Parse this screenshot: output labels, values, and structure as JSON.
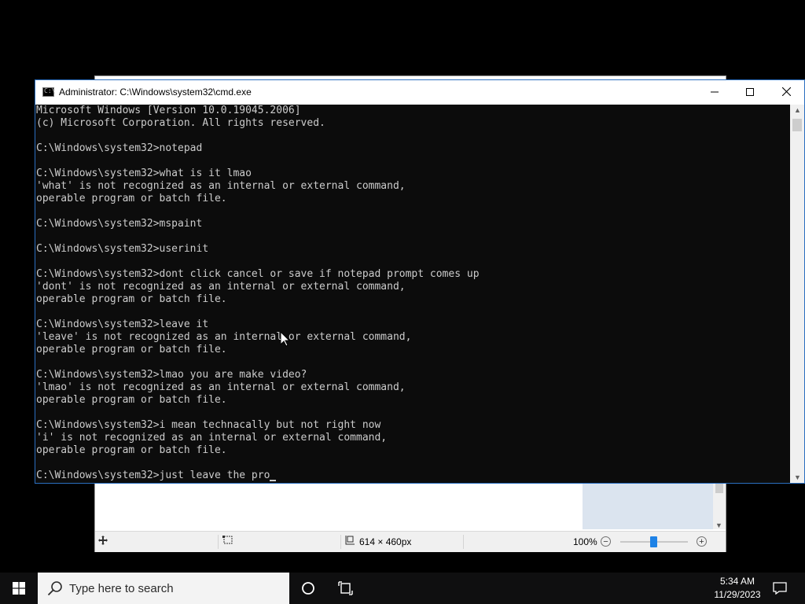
{
  "cmd": {
    "title": "Administrator: C:\\Windows\\system32\\cmd.exe",
    "icon_label": "C:\\",
    "window_buttons": {
      "minimize": "—",
      "maximize": "☐",
      "close": "✕"
    },
    "lines": [
      "Microsoft Windows [Version 10.0.19045.2006]",
      "(c) Microsoft Corporation. All rights reserved.",
      "",
      "C:\\Windows\\system32>notepad",
      "",
      "C:\\Windows\\system32>what is it lmao",
      "'what' is not recognized as an internal or external command,",
      "operable program or batch file.",
      "",
      "C:\\Windows\\system32>mspaint",
      "",
      "C:\\Windows\\system32>userinit",
      "",
      "C:\\Windows\\system32>dont click cancel or save if notepad prompt comes up",
      "'dont' is not recognized as an internal or external command,",
      "operable program or batch file.",
      "",
      "C:\\Windows\\system32>leave it",
      "'leave' is not recognized as an internal or external command,",
      "operable program or batch file.",
      "",
      "C:\\Windows\\system32>lmao you are make video?",
      "'lmao' is not recognized as an internal or external command,",
      "operable program or batch file.",
      "",
      "C:\\Windows\\system32>i mean technacally but not right now",
      "'i' is not recognized as an internal or external command,",
      "operable program or batch file.",
      ""
    ],
    "current_input": "C:\\Windows\\system32>just leave the pro"
  },
  "paint": {
    "statusbar": {
      "move_icon": "move-icon",
      "selection_icon": "selection-icon",
      "canvas_size_icon": "canvas-size-icon",
      "canvas_size": "614 × 460px",
      "zoom": "100%",
      "zoom_out": "−",
      "zoom_in": "+",
      "zoom_level": 0.5
    }
  },
  "taskbar": {
    "search_placeholder": "Type here to search",
    "time": "5:34 AM",
    "date": "11/29/2023"
  },
  "colors": {
    "console_bg": "#0c0c0c",
    "console_text": "#cccccc",
    "taskbar_bg": "#0f0f10",
    "accent": "#1e82e6"
  }
}
